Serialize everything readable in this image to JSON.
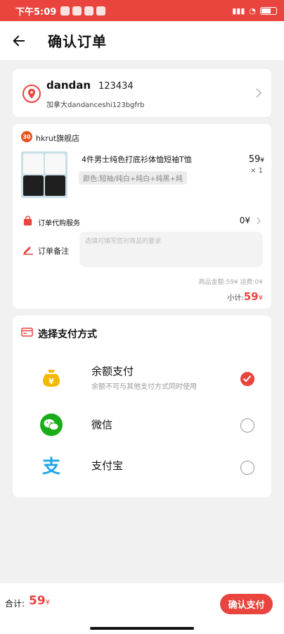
{
  "status_bar": {
    "time": "下午5:09"
  },
  "header": {
    "title": "确认订单"
  },
  "address": {
    "name": "dandan",
    "phone": "123434",
    "detail": "加拿大dandanceshi123bgfrb"
  },
  "shop": {
    "badge": "30",
    "name": "hkrut旗舰店",
    "product": {
      "title": "4件男士纯色打底衫体恤短袖T恤",
      "spec": "颜色:短袖/纯白+纯白+纯黑+纯",
      "price": "59",
      "currency": "¥",
      "qty": "× 1"
    },
    "service": {
      "label": "订单代购服务",
      "price": "0¥"
    },
    "note": {
      "label": "订单备注",
      "placeholder": "选填可填写您对商品的要求"
    },
    "amounts": "商品金额:59¥    运费:0¥",
    "subtotal": {
      "label": "小计:",
      "value": "59",
      "unit": "¥"
    }
  },
  "payment": {
    "title": "选择支付方式",
    "methods": [
      {
        "name": "余额支付",
        "desc": "余额不可与其他支付方式同时使用",
        "selected": true,
        "icon": "money-bag-icon"
      },
      {
        "name": "微信",
        "desc": "",
        "selected": false,
        "icon": "wechat-icon"
      },
      {
        "name": "支付宝",
        "desc": "",
        "selected": false,
        "icon": "alipay-icon"
      }
    ]
  },
  "bottom": {
    "total_label": "合计:",
    "total_value": "59",
    "total_unit": "¥",
    "confirm_label": "确认支付"
  },
  "colors": {
    "accent": "#e9443e",
    "wechat": "#1aad19",
    "alipay": "#1fa6e8",
    "money": "#f5b800"
  }
}
